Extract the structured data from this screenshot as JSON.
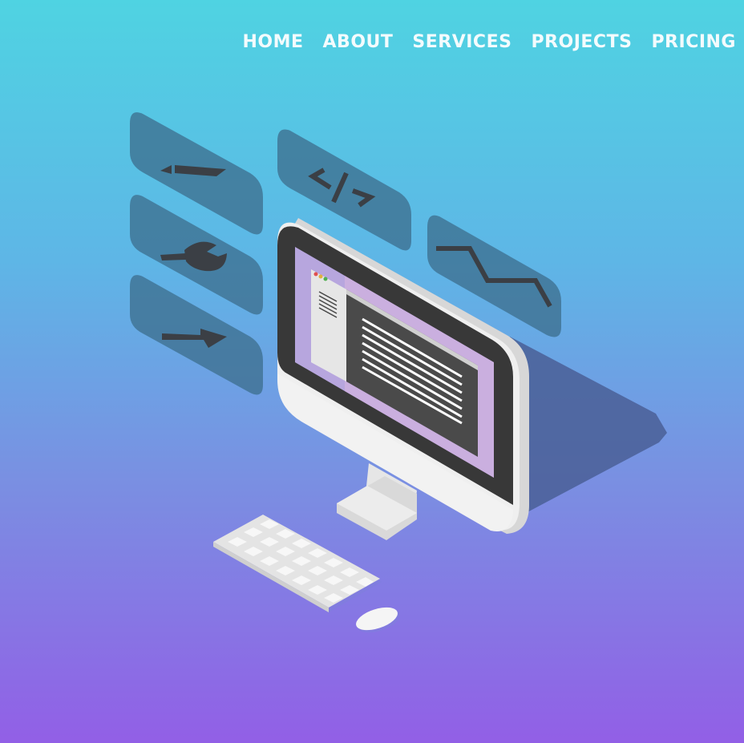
{
  "nav": {
    "items": [
      {
        "label": "HOME"
      },
      {
        "label": "ABOUT"
      },
      {
        "label": "SERVICES"
      },
      {
        "label": "PROJECTS"
      },
      {
        "label": "PRICING"
      }
    ]
  },
  "illustration": {
    "panels": [
      {
        "icon": "pencil-icon"
      },
      {
        "icon": "code-icon"
      },
      {
        "icon": "wrench-icon"
      },
      {
        "icon": "arrow-right-icon"
      },
      {
        "icon": "graph-line-icon"
      }
    ],
    "device": "desktop-computer",
    "colors": {
      "bg_top": "#4fd3e2",
      "bg_bottom": "#925fe6",
      "panel": "#3d6f8f",
      "screen_bezel": "#3a3a3a",
      "monitor_body": "#e8e8e8"
    }
  }
}
